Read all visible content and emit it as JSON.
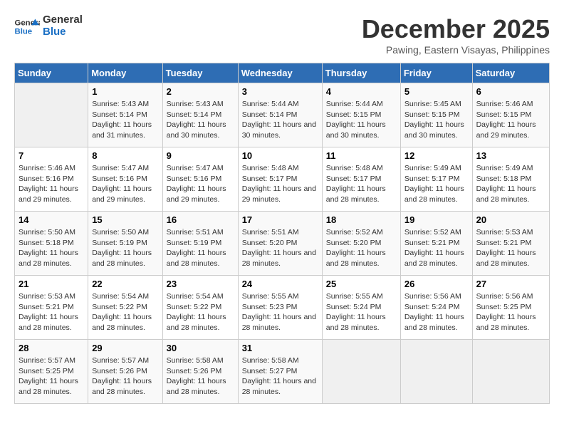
{
  "header": {
    "logo_line1": "General",
    "logo_line2": "Blue",
    "month_year": "December 2025",
    "location": "Pawing, Eastern Visayas, Philippines"
  },
  "weekdays": [
    "Sunday",
    "Monday",
    "Tuesday",
    "Wednesday",
    "Thursday",
    "Friday",
    "Saturday"
  ],
  "weeks": [
    [
      {
        "day": "",
        "sunrise": "",
        "sunset": "",
        "daylight": ""
      },
      {
        "day": "1",
        "sunrise": "Sunrise: 5:43 AM",
        "sunset": "Sunset: 5:14 PM",
        "daylight": "Daylight: 11 hours and 31 minutes."
      },
      {
        "day": "2",
        "sunrise": "Sunrise: 5:43 AM",
        "sunset": "Sunset: 5:14 PM",
        "daylight": "Daylight: 11 hours and 30 minutes."
      },
      {
        "day": "3",
        "sunrise": "Sunrise: 5:44 AM",
        "sunset": "Sunset: 5:14 PM",
        "daylight": "Daylight: 11 hours and 30 minutes."
      },
      {
        "day": "4",
        "sunrise": "Sunrise: 5:44 AM",
        "sunset": "Sunset: 5:15 PM",
        "daylight": "Daylight: 11 hours and 30 minutes."
      },
      {
        "day": "5",
        "sunrise": "Sunrise: 5:45 AM",
        "sunset": "Sunset: 5:15 PM",
        "daylight": "Daylight: 11 hours and 30 minutes."
      },
      {
        "day": "6",
        "sunrise": "Sunrise: 5:46 AM",
        "sunset": "Sunset: 5:15 PM",
        "daylight": "Daylight: 11 hours and 29 minutes."
      }
    ],
    [
      {
        "day": "7",
        "sunrise": "Sunrise: 5:46 AM",
        "sunset": "Sunset: 5:16 PM",
        "daylight": "Daylight: 11 hours and 29 minutes."
      },
      {
        "day": "8",
        "sunrise": "Sunrise: 5:47 AM",
        "sunset": "Sunset: 5:16 PM",
        "daylight": "Daylight: 11 hours and 29 minutes."
      },
      {
        "day": "9",
        "sunrise": "Sunrise: 5:47 AM",
        "sunset": "Sunset: 5:16 PM",
        "daylight": "Daylight: 11 hours and 29 minutes."
      },
      {
        "day": "10",
        "sunrise": "Sunrise: 5:48 AM",
        "sunset": "Sunset: 5:17 PM",
        "daylight": "Daylight: 11 hours and 29 minutes."
      },
      {
        "day": "11",
        "sunrise": "Sunrise: 5:48 AM",
        "sunset": "Sunset: 5:17 PM",
        "daylight": "Daylight: 11 hours and 28 minutes."
      },
      {
        "day": "12",
        "sunrise": "Sunrise: 5:49 AM",
        "sunset": "Sunset: 5:17 PM",
        "daylight": "Daylight: 11 hours and 28 minutes."
      },
      {
        "day": "13",
        "sunrise": "Sunrise: 5:49 AM",
        "sunset": "Sunset: 5:18 PM",
        "daylight": "Daylight: 11 hours and 28 minutes."
      }
    ],
    [
      {
        "day": "14",
        "sunrise": "Sunrise: 5:50 AM",
        "sunset": "Sunset: 5:18 PM",
        "daylight": "Daylight: 11 hours and 28 minutes."
      },
      {
        "day": "15",
        "sunrise": "Sunrise: 5:50 AM",
        "sunset": "Sunset: 5:19 PM",
        "daylight": "Daylight: 11 hours and 28 minutes."
      },
      {
        "day": "16",
        "sunrise": "Sunrise: 5:51 AM",
        "sunset": "Sunset: 5:19 PM",
        "daylight": "Daylight: 11 hours and 28 minutes."
      },
      {
        "day": "17",
        "sunrise": "Sunrise: 5:51 AM",
        "sunset": "Sunset: 5:20 PM",
        "daylight": "Daylight: 11 hours and 28 minutes."
      },
      {
        "day": "18",
        "sunrise": "Sunrise: 5:52 AM",
        "sunset": "Sunset: 5:20 PM",
        "daylight": "Daylight: 11 hours and 28 minutes."
      },
      {
        "day": "19",
        "sunrise": "Sunrise: 5:52 AM",
        "sunset": "Sunset: 5:21 PM",
        "daylight": "Daylight: 11 hours and 28 minutes."
      },
      {
        "day": "20",
        "sunrise": "Sunrise: 5:53 AM",
        "sunset": "Sunset: 5:21 PM",
        "daylight": "Daylight: 11 hours and 28 minutes."
      }
    ],
    [
      {
        "day": "21",
        "sunrise": "Sunrise: 5:53 AM",
        "sunset": "Sunset: 5:21 PM",
        "daylight": "Daylight: 11 hours and 28 minutes."
      },
      {
        "day": "22",
        "sunrise": "Sunrise: 5:54 AM",
        "sunset": "Sunset: 5:22 PM",
        "daylight": "Daylight: 11 hours and 28 minutes."
      },
      {
        "day": "23",
        "sunrise": "Sunrise: 5:54 AM",
        "sunset": "Sunset: 5:22 PM",
        "daylight": "Daylight: 11 hours and 28 minutes."
      },
      {
        "day": "24",
        "sunrise": "Sunrise: 5:55 AM",
        "sunset": "Sunset: 5:23 PM",
        "daylight": "Daylight: 11 hours and 28 minutes."
      },
      {
        "day": "25",
        "sunrise": "Sunrise: 5:55 AM",
        "sunset": "Sunset: 5:24 PM",
        "daylight": "Daylight: 11 hours and 28 minutes."
      },
      {
        "day": "26",
        "sunrise": "Sunrise: 5:56 AM",
        "sunset": "Sunset: 5:24 PM",
        "daylight": "Daylight: 11 hours and 28 minutes."
      },
      {
        "day": "27",
        "sunrise": "Sunrise: 5:56 AM",
        "sunset": "Sunset: 5:25 PM",
        "daylight": "Daylight: 11 hours and 28 minutes."
      }
    ],
    [
      {
        "day": "28",
        "sunrise": "Sunrise: 5:57 AM",
        "sunset": "Sunset: 5:25 PM",
        "daylight": "Daylight: 11 hours and 28 minutes."
      },
      {
        "day": "29",
        "sunrise": "Sunrise: 5:57 AM",
        "sunset": "Sunset: 5:26 PM",
        "daylight": "Daylight: 11 hours and 28 minutes."
      },
      {
        "day": "30",
        "sunrise": "Sunrise: 5:58 AM",
        "sunset": "Sunset: 5:26 PM",
        "daylight": "Daylight: 11 hours and 28 minutes."
      },
      {
        "day": "31",
        "sunrise": "Sunrise: 5:58 AM",
        "sunset": "Sunset: 5:27 PM",
        "daylight": "Daylight: 11 hours and 28 minutes."
      },
      {
        "day": "",
        "sunrise": "",
        "sunset": "",
        "daylight": ""
      },
      {
        "day": "",
        "sunrise": "",
        "sunset": "",
        "daylight": ""
      },
      {
        "day": "",
        "sunrise": "",
        "sunset": "",
        "daylight": ""
      }
    ]
  ]
}
